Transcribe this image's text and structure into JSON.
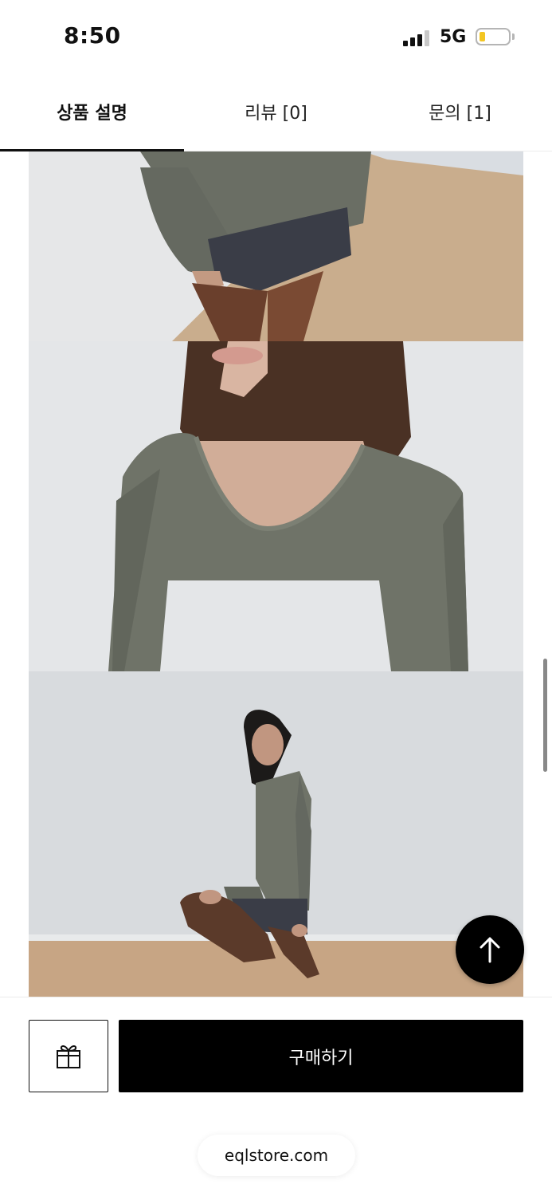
{
  "status_bar": {
    "time": "8:50",
    "network": "5G",
    "battery_level": 0.2,
    "battery_color": "#f3c623"
  },
  "tabs": [
    {
      "label": "상품 설명",
      "active": true
    },
    {
      "label": "리뷰 [0]",
      "active": false
    },
    {
      "label": "문의 [1]",
      "active": false
    }
  ],
  "photos": [
    {
      "subject": "model-torso-skirt"
    },
    {
      "subject": "model-neckline-closeup"
    },
    {
      "subject": "model-kneeling-full"
    }
  ],
  "actions": {
    "gift_icon": "gift-icon",
    "buy_label": "구매하기",
    "scroll_top_icon": "arrow-up-icon"
  },
  "browser": {
    "url": "eqlstore.com"
  },
  "colors": {
    "accent": "#000000",
    "garment": "#6f7368"
  }
}
